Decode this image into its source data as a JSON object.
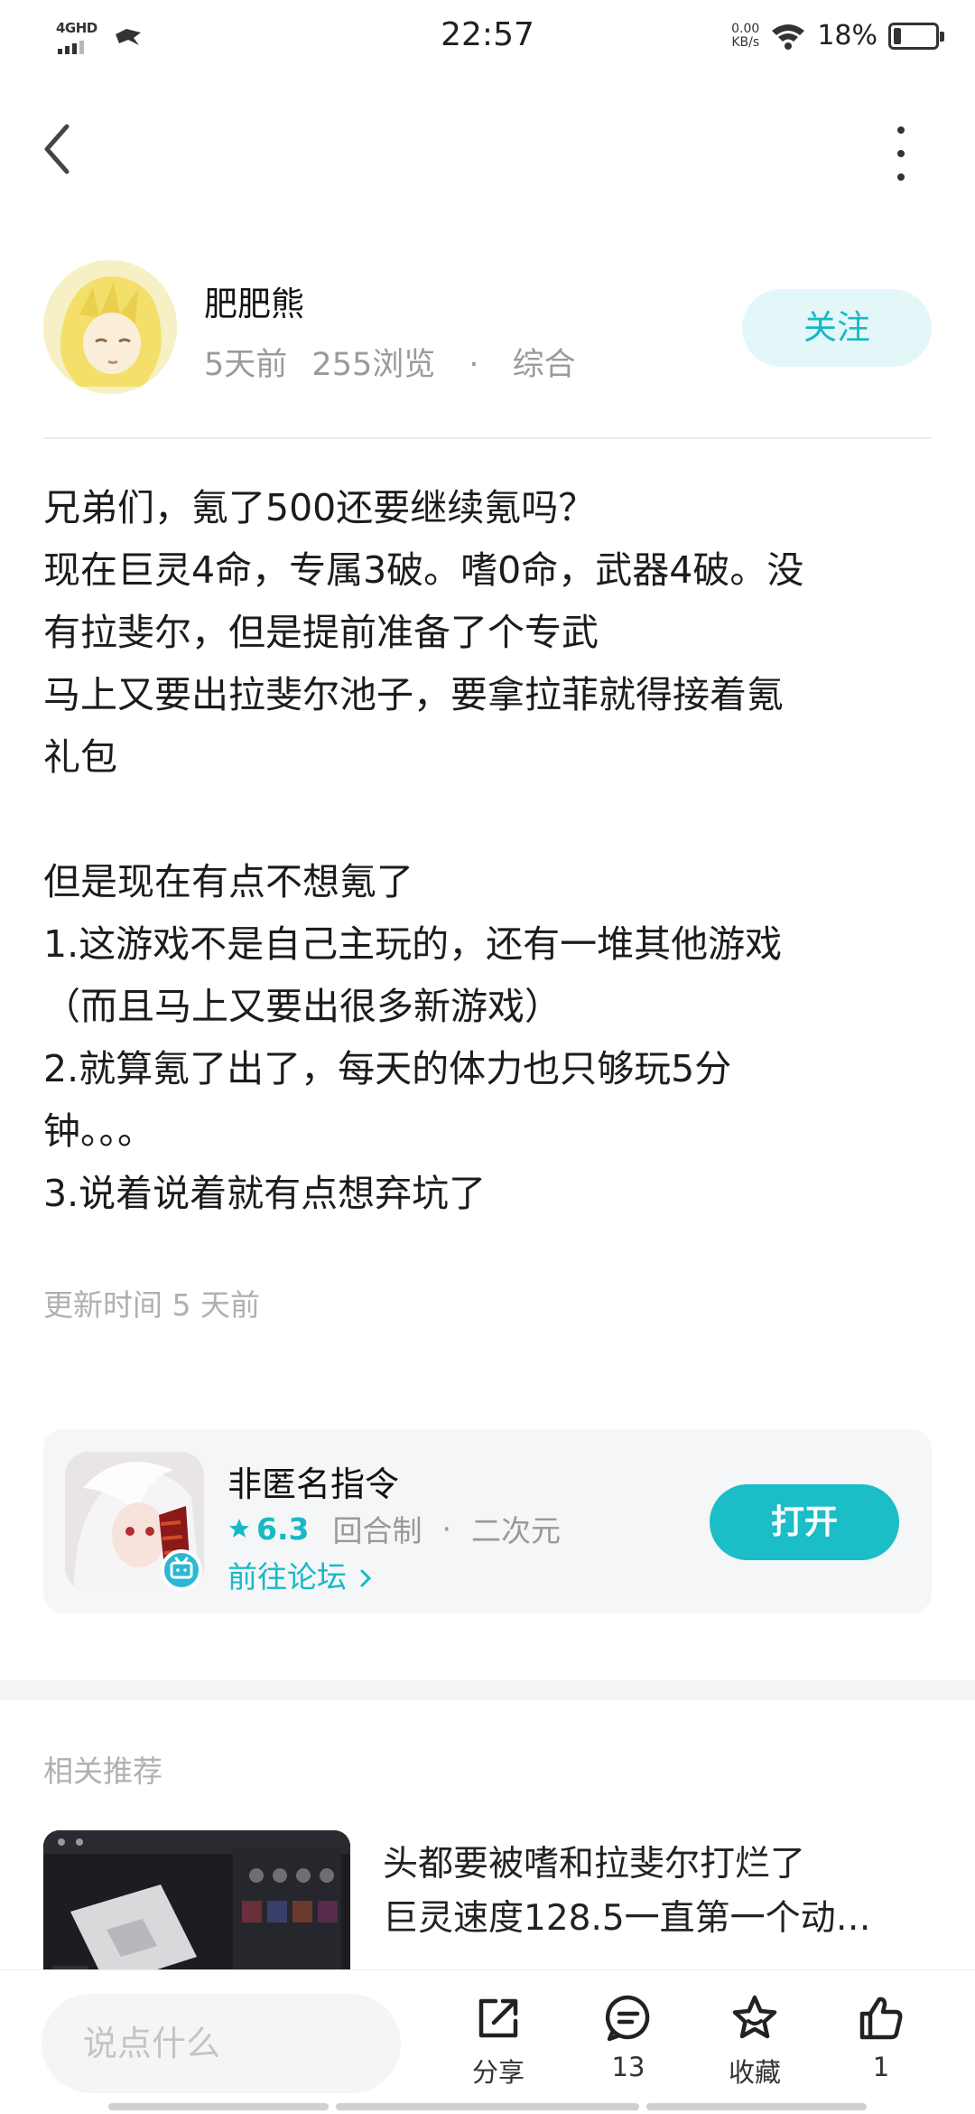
{
  "status_bar": {
    "network": "4GHD",
    "time": "22:57",
    "speed_value": "0.00",
    "speed_unit": "KB/s",
    "battery_percent": "18%",
    "battery_level": 0.18
  },
  "author": {
    "name": "肥肥熊",
    "posted": "5天前",
    "views": "255浏览",
    "separator": "·",
    "category": "综合",
    "follow_label": "关注"
  },
  "post": {
    "lines": [
      "兄弟们，氪了500还要继续氪吗？",
      "现在巨灵4命，专属3破。嗜0命，武器4破。没",
      "有拉斐尔，但是提前准备了个专武",
      "马上又要出拉斐尔池子，要拿拉菲就得接着氪",
      "礼包",
      "",
      "但是现在有点不想氪了",
      "1.这游戏不是自己主玩的，还有一堆其他游戏",
      "（而且马上又要出很多新游戏）",
      "2.就算氪了出了，每天的体力也只够玩5分",
      "钟。。。",
      "3.说着说着就有点想弃坑了"
    ],
    "update_time": "更新时间 5 天前"
  },
  "game_card": {
    "name": "非匿名指令",
    "score": "6.3",
    "genre": "回合制",
    "separator": "·",
    "style": "二次元",
    "forum_link": "前往论坛",
    "open_label": "打开",
    "accent_color": "#1bbdc7"
  },
  "related": {
    "title": "相关推荐",
    "items": [
      {
        "title_line1": "头都要被嗜和拉斐尔打烂了",
        "title_line2": "巨灵速度128.5一直第一个动…"
      }
    ]
  },
  "bottom_bar": {
    "comment_placeholder": "说点什么",
    "share_label": "分享",
    "comments_count": "13",
    "favorite_label": "收藏",
    "likes_count": "1"
  }
}
